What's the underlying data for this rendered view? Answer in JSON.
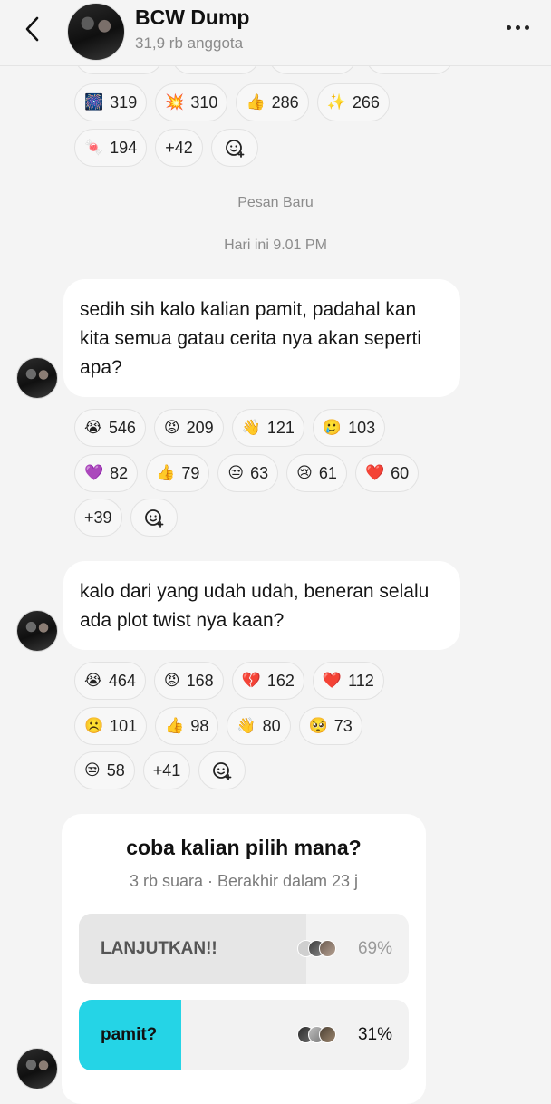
{
  "header": {
    "title": "BCW Dump",
    "members": "31,9 rb anggota"
  },
  "top_reactions": {
    "row1": [
      {
        "emoji": "🎆",
        "count": "319"
      },
      {
        "emoji": "💥",
        "count": "310"
      },
      {
        "emoji": "👍",
        "count": "286"
      },
      {
        "emoji": "✨",
        "count": "266"
      }
    ],
    "row2": [
      {
        "emoji": "🍬",
        "count": "194"
      },
      {
        "emoji": "",
        "count": "+42"
      }
    ]
  },
  "divider": {
    "new_messages": "Pesan Baru",
    "timestamp": "Hari ini 9.01 PM"
  },
  "messages": [
    {
      "text": "sedih sih kalo kalian pamit, padahal kan kita semua gatau cerita nya akan seperti apa?",
      "reactions": [
        [
          {
            "emoji": "😭",
            "count": "546"
          },
          {
            "emoji": "😡",
            "count": "209"
          },
          {
            "emoji": "👋",
            "count": "121"
          },
          {
            "emoji": "🥲",
            "count": "103"
          }
        ],
        [
          {
            "emoji": "💜",
            "count": "82"
          },
          {
            "emoji": "👍",
            "count": "79"
          },
          {
            "emoji": "😒",
            "count": "63"
          },
          {
            "emoji": "😢",
            "count": "61"
          },
          {
            "emoji": "❤️",
            "count": "60"
          }
        ],
        [
          {
            "emoji": "",
            "count": "+39"
          }
        ]
      ]
    },
    {
      "text": "kalo dari yang udah udah, beneran selalu ada plot twist nya kaan?",
      "reactions": [
        [
          {
            "emoji": "😭",
            "count": "464"
          },
          {
            "emoji": "😡",
            "count": "168"
          },
          {
            "emoji": "💔",
            "count": "162"
          },
          {
            "emoji": "❤️",
            "count": "112"
          }
        ],
        [
          {
            "emoji": "☹️",
            "count": "101"
          },
          {
            "emoji": "👍",
            "count": "98"
          },
          {
            "emoji": "👋",
            "count": "80"
          },
          {
            "emoji": "🥺",
            "count": "73"
          }
        ],
        [
          {
            "emoji": "😒",
            "count": "58"
          },
          {
            "emoji": "",
            "count": "+41"
          }
        ]
      ]
    }
  ],
  "poll": {
    "question": "coba kalian pilih mana?",
    "meta": "3 rb suara · Berakhir dalam 23 j",
    "options": [
      {
        "label": "LANJUTKAN!!",
        "percent": "69%",
        "fraction": 0.69,
        "fill_color": "#e6e6e6",
        "label_color": "#555555",
        "pct_color": "#9a9a9a"
      },
      {
        "label": "pamit?",
        "percent": "31%",
        "fraction": 0.31,
        "fill_color": "#25d4e6",
        "label_color": "#111111",
        "pct_color": "#111111"
      }
    ]
  },
  "icons": {
    "back": "chevron-left-icon",
    "more": "more-horizontal-icon",
    "add_reaction": "add-reaction-icon"
  }
}
